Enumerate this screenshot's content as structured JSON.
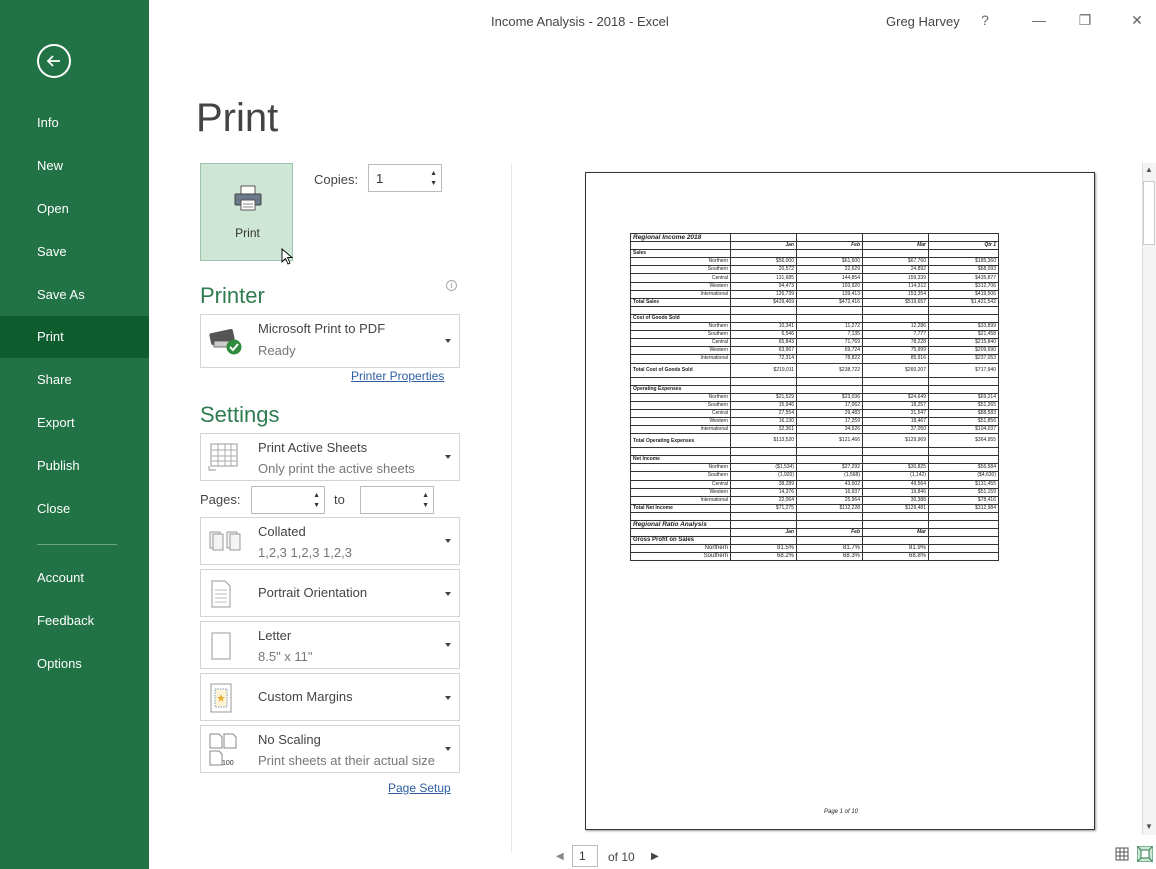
{
  "window": {
    "title": "Income Analysis - 2018  -  Excel",
    "user": "Greg Harvey",
    "help": "?",
    "minimize": "—",
    "restore": "❐",
    "close": "✕"
  },
  "sidebar": {
    "back_icon": "back-arrow-icon",
    "items": [
      {
        "label": "Info"
      },
      {
        "label": "New"
      },
      {
        "label": "Open"
      },
      {
        "label": "Save"
      },
      {
        "label": "Save As"
      },
      {
        "label": "Print",
        "active": true
      },
      {
        "label": "Share"
      },
      {
        "label": "Export"
      },
      {
        "label": "Publish"
      },
      {
        "label": "Close"
      },
      {
        "label": "Account"
      },
      {
        "label": "Feedback"
      },
      {
        "label": "Options"
      }
    ]
  },
  "print": {
    "heading": "Print",
    "button_label": "Print",
    "copies_label": "Copies:",
    "copies_value": "1"
  },
  "printer": {
    "section_title": "Printer",
    "name": "Microsoft Print to PDF",
    "status": "Ready",
    "properties_link": "Printer Properties"
  },
  "settings": {
    "section_title": "Settings",
    "what": {
      "main": "Print Active Sheets",
      "sub": "Only print the active sheets"
    },
    "pages_label": "Pages:",
    "to_label": "to",
    "pages_from": "",
    "pages_to": "",
    "collation": {
      "main": "Collated",
      "sub": "1,2,3    1,2,3    1,2,3"
    },
    "orientation": {
      "main": "Portrait Orientation"
    },
    "paper": {
      "main": "Letter",
      "sub": "8.5\" x 11\""
    },
    "margins": {
      "main": "Custom Margins"
    },
    "scaling": {
      "main": "No Scaling",
      "sub": "Print sheets at their actual size",
      "icon_text": "100"
    },
    "page_setup_link": "Page Setup"
  },
  "preview": {
    "sheet_title": "Regional Income 2018",
    "columns": [
      "",
      "Jan",
      "Feb",
      "Mar",
      "Qtr 1"
    ],
    "sections": [
      {
        "title": "Sales",
        "rows": [
          {
            "label": "Northern",
            "values": [
              "$56,000",
              "$61,600",
              "$67,760",
              "$185,360"
            ]
          },
          {
            "label": "Southern",
            "values": [
              "20,572",
              "22,629",
              "24,892",
              "$68,093"
            ]
          },
          {
            "label": "Central",
            "values": [
              "131,685",
              "144,854",
              "159,339",
              "$435,877"
            ]
          },
          {
            "label": "Western",
            "values": [
              "94,473",
              "103,920",
              "114,312",
              "$312,706"
            ]
          },
          {
            "label": "International",
            "values": [
              "126,739",
              "139,413",
              "153,354",
              "$419,506"
            ]
          }
        ],
        "total": {
          "label": "Total Sales",
          "values": [
            "$429,469",
            "$472,416",
            "$519,657",
            "$1,421,542"
          ]
        }
      },
      {
        "title": "Cost of Goods Sold",
        "rows": [
          {
            "label": "Northern",
            "values": [
              "10,341",
              "11,272",
              "12,286",
              "$33,899"
            ]
          },
          {
            "label": "Southern",
            "values": [
              "6,546",
              "7,135",
              "7,777",
              "$21,458"
            ]
          },
          {
            "label": "Central",
            "values": [
              "65,843",
              "71,769",
              "78,228",
              "$215,840"
            ]
          },
          {
            "label": "Western",
            "values": [
              "63,967",
              "69,724",
              "75,999",
              "$209,690"
            ]
          },
          {
            "label": "International",
            "values": [
              "72,314",
              "78,822",
              "85,916",
              "$237,053"
            ]
          }
        ],
        "total": {
          "label": "Total Cost of Goods Sold",
          "values": [
            "$219,011",
            "$238,722",
            "$260,207",
            "$717,940"
          ]
        }
      },
      {
        "title": "Operating Expenses",
        "rows": [
          {
            "label": "Northern",
            "values": [
              "$21,529",
              "$23,036",
              "$24,649",
              "$69,214"
            ]
          },
          {
            "label": "Southern",
            "values": [
              "15,946",
              "17,062",
              "18,257",
              "$51,265"
            ]
          },
          {
            "label": "Central",
            "values": [
              "27,554",
              "29,483",
              "31,547",
              "$88,583"
            ]
          },
          {
            "label": "Western",
            "values": [
              "16,130",
              "17,259",
              "18,467",
              "$51,856"
            ]
          },
          {
            "label": "International",
            "values": [
              "32,361",
              "34,626",
              "37,050",
              "$104,037"
            ]
          }
        ],
        "total": {
          "label": "Total Operating Expenses",
          "values": [
            "$113,520",
            "$121,466",
            "$129,969",
            "$364,955"
          ]
        }
      },
      {
        "title": "Net Income",
        "rows": [
          {
            "label": "Northern",
            "values": [
              "($1,534)",
              "$27,292",
              "$30,825",
              "$56,584"
            ]
          },
          {
            "label": "Southern",
            "values": [
              "(1,920)",
              "(1,568)",
              "(1,142)",
              "($4,630)"
            ]
          },
          {
            "label": "Central",
            "values": [
              "38,289",
              "43,602",
              "49,564",
              "$131,455"
            ]
          },
          {
            "label": "Western",
            "values": [
              "14,376",
              "16,937",
              "19,846",
              "$51,159"
            ]
          },
          {
            "label": "International",
            "values": [
              "22,064",
              "25,964",
              "30,388",
              "$78,416"
            ]
          }
        ],
        "total": {
          "label": "Total Net Income",
          "values": [
            "$71,275",
            "$112,228",
            "$129,481",
            "$312,984"
          ]
        }
      }
    ],
    "ratio_title": "Regional Ratio Analysis",
    "ratio_columns": [
      "",
      "Jan",
      "Feb",
      "Mar"
    ],
    "ratio_section": "Gross Profit on Sales",
    "ratio_rows": [
      {
        "label": "Northern",
        "values": [
          "81.5%",
          "81.7%",
          "81.9%"
        ]
      },
      {
        "label": "Southern",
        "values": [
          "68.2%",
          "68.3%",
          "68.8%"
        ]
      }
    ],
    "footer": "Page 1 of 10",
    "current_page": "1",
    "of_pages": "of 10"
  },
  "icons": {
    "printer": "printer-icon",
    "pdf_printer": "printer-ready-icon",
    "info": "info-icon"
  },
  "colors": {
    "sidebar": "#217346",
    "sidebar_active": "#0f5c2f",
    "section_title": "#2e7c4f",
    "link": "#2e5fa3",
    "print_button": "#cde6d6"
  }
}
